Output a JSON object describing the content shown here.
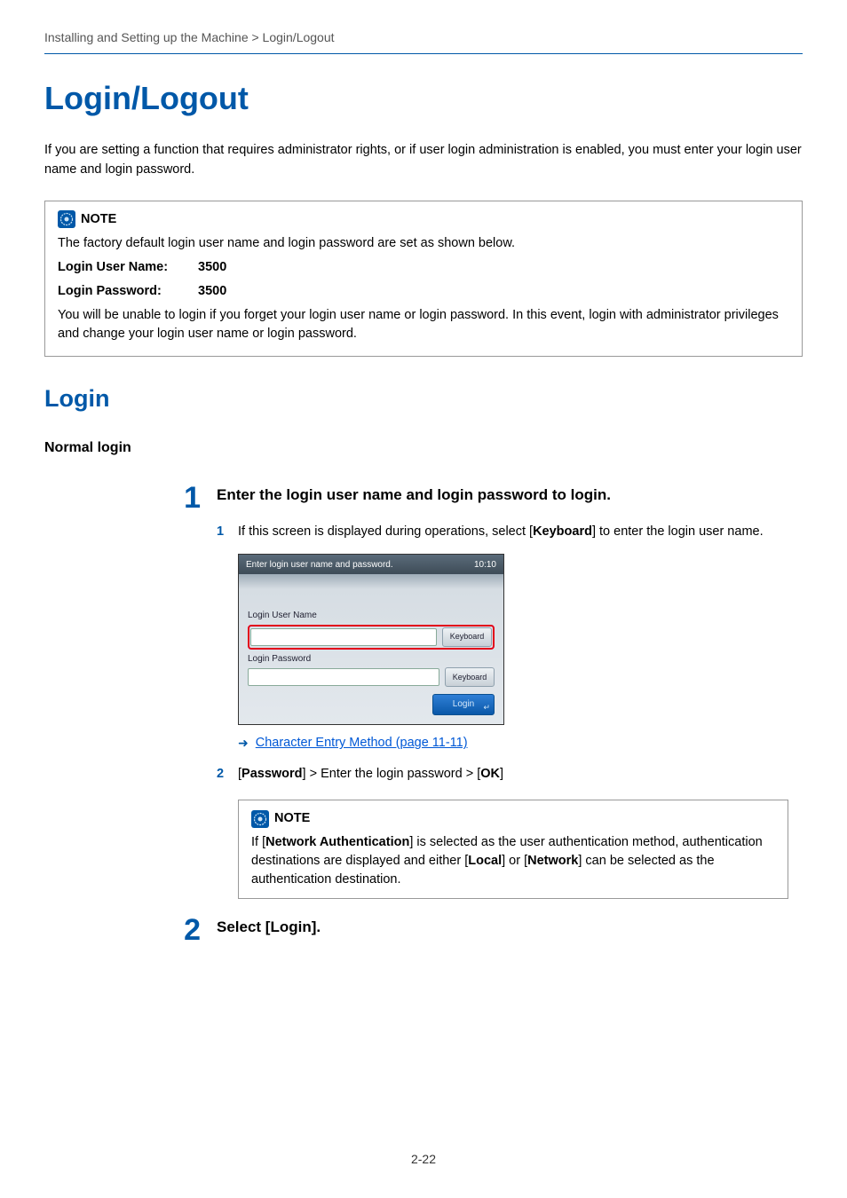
{
  "breadcrumb": "Installing and Setting up the Machine > Login/Logout",
  "h1": "Login/Logout",
  "intro": "If you are setting a function that requires administrator rights, or if user login administration is enabled, you must enter your login user name and login password.",
  "note1": {
    "title": "NOTE",
    "line1": "The factory default login user name and login password are set as shown below.",
    "userLabel": "Login User Name:",
    "userValue": "3500",
    "passLabel": "Login Password:",
    "passValue": "3500",
    "line2": "You will be unable to login if you forget your login user name or login password. In this event, login with administrator privileges and change your login user name or login password."
  },
  "h2": "Login",
  "subheading": "Normal login",
  "step1": {
    "num": "1",
    "title": "Enter the login user name and login password to login.",
    "sub1": {
      "num": "1",
      "pre": "If this screen is displayed during operations, select [",
      "bold": "Keyboard",
      "post": "] to enter the login user name."
    },
    "screen": {
      "header": "Enter login user name and password.",
      "time": "10:10",
      "userLabel": "Login User Name",
      "passLabel": "Login Password",
      "keyboardBtn": "Keyboard",
      "loginBtn": "Login"
    },
    "link": "Character Entry Method (page 11-11)",
    "sub2": {
      "num": "2",
      "pre": "[",
      "b1": "Password",
      "mid": "] > Enter the login password > [",
      "b2": "OK",
      "post": "]"
    },
    "innerNote": {
      "title": "NOTE",
      "pre": "If [",
      "b1": "Network Authentication",
      "mid1": "] is selected as the user authentication method, authentication destinations are displayed and either [",
      "b2": "Local",
      "mid2": "] or [",
      "b3": "Network",
      "post": "] can be selected as the authentication destination."
    }
  },
  "step2": {
    "num": "2",
    "title": "Select [Login]."
  },
  "pageNum": "2-22"
}
